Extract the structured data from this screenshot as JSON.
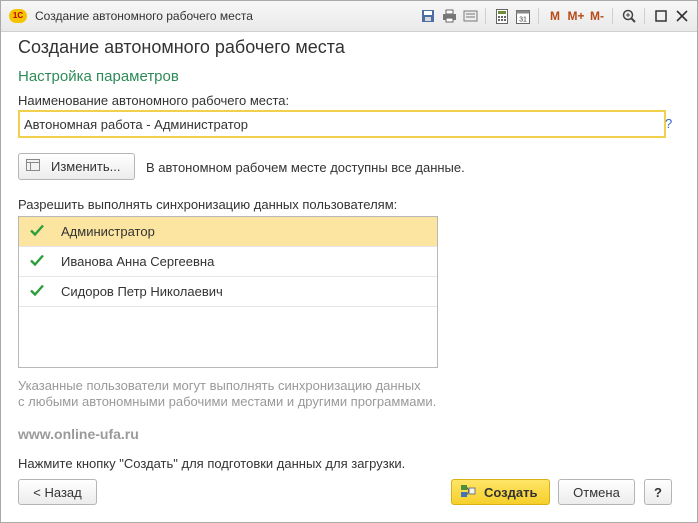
{
  "window": {
    "logo_text": "1С",
    "title": "Создание автономного рабочего места",
    "toolbar": {
      "m": "M",
      "m_plus": "M+",
      "m_minus": "M-",
      "calendar_day": "31"
    }
  },
  "heading": "Создание автономного рабочего места",
  "section_title": "Настройка параметров",
  "name_field": {
    "label": "Наименование автономного рабочего места:",
    "value": "Автономная работа - Администратор",
    "help": "?"
  },
  "change_button": {
    "label": "Изменить..."
  },
  "data_note": "В автономном рабочем месте доступны все данные.",
  "users": {
    "label": "Разрешить выполнять синхронизацию данных пользователям:",
    "items": [
      {
        "name": "Администратор",
        "checked": true,
        "selected": true
      },
      {
        "name": "Иванова Анна Сергеевна",
        "checked": true,
        "selected": false
      },
      {
        "name": "Сидоров Петр Николаевич",
        "checked": true,
        "selected": false
      }
    ]
  },
  "hint_lines": [
    "Указанные пользователи могут выполнять синхронизацию данных",
    "с любыми автономными рабочими местами и другими программами."
  ],
  "watermark": "www.online-ufa.ru",
  "bottom_note": "Нажмите кнопку \"Создать\" для подготовки данных для загрузки.",
  "buttons": {
    "back": "< Назад",
    "create": "Создать",
    "cancel": "Отмена",
    "help": "?"
  },
  "colors": {
    "section": "#2e8b57",
    "input_focus_border": "#f1d04b",
    "selected_row": "#fbe5a0",
    "check": "#2e9e3c",
    "primary_button": "#f5cf2b"
  }
}
